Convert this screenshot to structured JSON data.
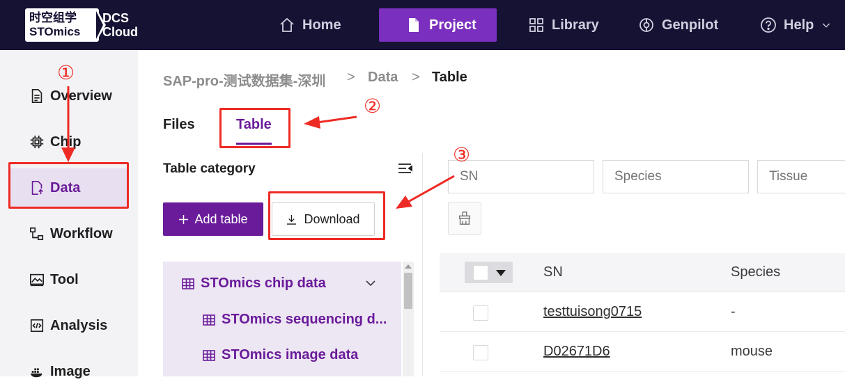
{
  "brand": {
    "cn_name": "时空组学",
    "sto_name": "STOmics",
    "dcs_line1": "DCS",
    "dcs_line2": "Cloud"
  },
  "topnav": {
    "items": [
      {
        "label": "Home",
        "icon": "home-icon"
      },
      {
        "label": "Project",
        "icon": "document-icon",
        "active": true
      },
      {
        "label": "Library",
        "icon": "grid-icon"
      },
      {
        "label": "Genpilot",
        "icon": "compass-icon"
      },
      {
        "label": "Help",
        "icon": "question-circle-icon"
      }
    ]
  },
  "sidebar": {
    "items": [
      {
        "label": "Overview",
        "icon": "file-text-icon"
      },
      {
        "label": "Chip",
        "icon": "chip-icon"
      },
      {
        "label": "Data",
        "icon": "file-upload-icon",
        "active": true
      },
      {
        "label": "Workflow",
        "icon": "workflow-icon"
      },
      {
        "label": "Tool",
        "icon": "image-chart-icon"
      },
      {
        "label": "Analysis",
        "icon": "code-icon"
      },
      {
        "label": "Image",
        "icon": "docker-icon"
      }
    ]
  },
  "breadcrumb": {
    "project": "SAP-pro-测试数据集-深圳",
    "section": "Data",
    "current": "Table",
    "separator": ">"
  },
  "tabs": [
    {
      "label": "Files"
    },
    {
      "label": "Table",
      "active": true
    }
  ],
  "panel": {
    "title": "Table category",
    "add_button": "Add table",
    "download_button": "Download",
    "tree": [
      {
        "label": "STOmics chip data",
        "expanded": true
      },
      {
        "label": "STOmics sequencing d..."
      },
      {
        "label": "STOmics image data"
      }
    ]
  },
  "filters": {
    "sn_placeholder": "SN",
    "species_placeholder": "Species",
    "tissue_placeholder": "Tissue"
  },
  "table": {
    "columns": [
      "SN",
      "Species"
    ],
    "rows": [
      {
        "sn": "testtuisong0715",
        "species": "-"
      },
      {
        "sn": "D02671D6",
        "species": "mouse"
      }
    ]
  },
  "annotations": {
    "marker_1": "①",
    "marker_2": "②",
    "marker_3": "③",
    "color": "#ee2a24"
  },
  "colors": {
    "topbar": "#161233",
    "accent": "#7b2fbe",
    "accent_dark": "#6a1b9a",
    "sidebar_bg": "#f3f3f6"
  }
}
